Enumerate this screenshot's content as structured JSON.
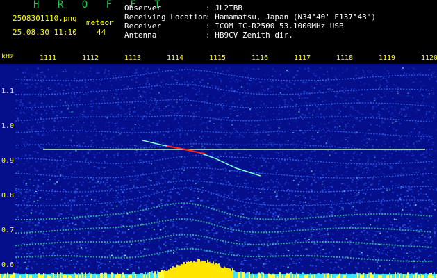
{
  "app": {
    "title": "H R O F F T",
    "file": "2508301110.png",
    "datetime": "25.08.30 11:10",
    "meteor_label": "meteor",
    "meteor_count": "44"
  },
  "info": {
    "labels": [
      "Observer",
      "Receiving Location",
      "Receiver",
      "Antenna"
    ],
    "values": [
      ": JL2TBB",
      ": Hamamatsu, Japan (N34°40' E137°43')",
      ": ICOM IC-R2500 53.1000MHz USB",
      ": HB9CV Zenith dir."
    ]
  },
  "spectrogram": {
    "unit": "kHz",
    "x_ticks": [
      "1111",
      "1112",
      "1113",
      "1114",
      "1115",
      "1116",
      "1117",
      "1118",
      "1119",
      "1120"
    ],
    "y_ticks": [
      "1.1",
      "1.0",
      "0.9",
      "0.8",
      "0.7",
      "0.6"
    ],
    "colors": {
      "background": "#050f8c",
      "noise": "#2a5cff",
      "trace": "#ffe600",
      "echo": "#ff2020",
      "carrier": "#c8ffb0"
    }
  }
}
